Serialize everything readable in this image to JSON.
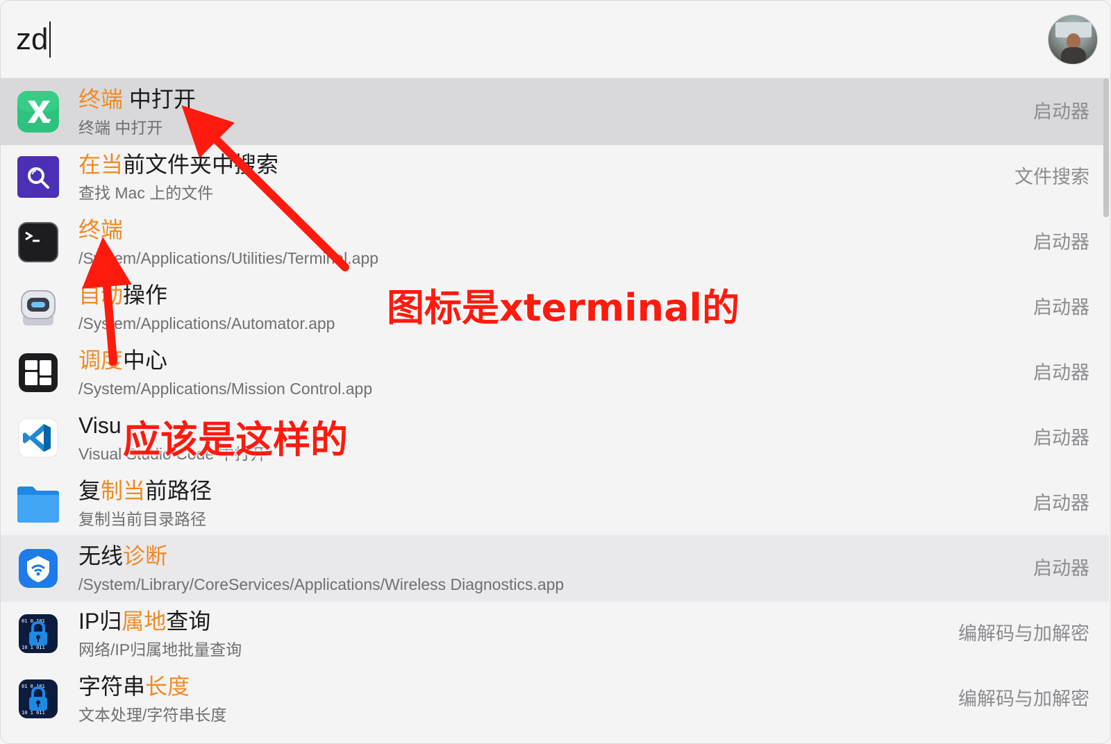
{
  "search": {
    "query": "zd"
  },
  "results": [
    {
      "title_parts": [
        {
          "text": "终端",
          "hl": true
        },
        {
          "text": " 中打开",
          "hl": false
        }
      ],
      "subtitle": "终端 中打开",
      "category": "启动器",
      "icon": "xterminal-icon",
      "state": "selected"
    },
    {
      "title_parts": [
        {
          "text": "在当",
          "hl": true
        },
        {
          "text": "前文件夹中搜索",
          "hl": false
        }
      ],
      "subtitle": "查找 Mac 上的文件",
      "category": "文件搜索",
      "icon": "file-search-icon",
      "state": ""
    },
    {
      "title_parts": [
        {
          "text": "终端",
          "hl": true
        }
      ],
      "subtitle": "/System/Applications/Utilities/Terminal.app",
      "category": "启动器",
      "icon": "terminal-icon",
      "state": ""
    },
    {
      "title_parts": [
        {
          "text": "自动",
          "hl": true
        },
        {
          "text": "操作",
          "hl": false
        }
      ],
      "subtitle": "/System/Applications/Automator.app",
      "category": "启动器",
      "icon": "automator-icon",
      "state": ""
    },
    {
      "title_parts": [
        {
          "text": "调度",
          "hl": true
        },
        {
          "text": "中心",
          "hl": false
        }
      ],
      "subtitle": "/System/Applications/Mission Control.app",
      "category": "启动器",
      "icon": "mission-control-icon",
      "state": ""
    },
    {
      "title_parts": [
        {
          "text": "Visu",
          "hl": false
        }
      ],
      "subtitle": "Visual Studio Code 中打开",
      "category": "启动器",
      "icon": "vscode-icon",
      "state": ""
    },
    {
      "title_parts": [
        {
          "text": "复",
          "hl": false
        },
        {
          "text": "制当",
          "hl": true
        },
        {
          "text": "前路径",
          "hl": false
        }
      ],
      "subtitle": "复制当前目录路径",
      "category": "启动器",
      "icon": "folder-icon",
      "state": ""
    },
    {
      "title_parts": [
        {
          "text": "无线",
          "hl": false
        },
        {
          "text": "诊断",
          "hl": true
        }
      ],
      "subtitle": "/System/Library/CoreServices/Applications/Wireless Diagnostics.app",
      "category": "启动器",
      "icon": "wireless-diagnostics-icon",
      "state": "hovered"
    },
    {
      "title_parts": [
        {
          "text": "IP归",
          "hl": false
        },
        {
          "text": "属地",
          "hl": true
        },
        {
          "text": "查询",
          "hl": false
        }
      ],
      "subtitle": "网络/IP归属地批量查询",
      "category": "编解码与加解密",
      "icon": "lock-code-icon",
      "state": ""
    },
    {
      "title_parts": [
        {
          "text": "字符串",
          "hl": false
        },
        {
          "text": "长度",
          "hl": true
        }
      ],
      "subtitle": "文本处理/字符串长度",
      "category": "编解码与加解密",
      "icon": "lock-code-icon",
      "state": ""
    }
  ],
  "annotations": {
    "note_1": "图标是xterminal的",
    "note_2": "应该是这样的",
    "color": "#ff1a0e"
  },
  "colors": {
    "highlight": "#f08a24",
    "selected_row": "#d9d9db"
  }
}
